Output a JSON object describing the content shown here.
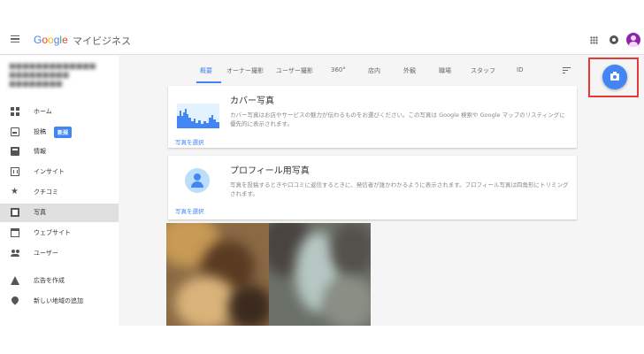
{
  "header": {
    "logo_parts": [
      "G",
      "o",
      "o",
      "g",
      "l",
      "e"
    ],
    "product": "マイビジネス"
  },
  "sidebar": {
    "business_name": "■■■■■■■■■■■■■ ■■■■■■■■■ ■■■■■■■■",
    "items": [
      {
        "label": "ホーム",
        "icon": "home-icon"
      },
      {
        "label": "投稿",
        "icon": "post-icon",
        "badge": "新規"
      },
      {
        "label": "情報",
        "icon": "info-icon"
      },
      {
        "label": "インサイト",
        "icon": "insight-icon"
      },
      {
        "label": "クチコミ",
        "icon": "star-icon",
        "glyph": "★"
      },
      {
        "label": "写真",
        "icon": "photo-icon",
        "active": true
      },
      {
        "label": "ウェブサイト",
        "icon": "website-icon"
      },
      {
        "label": "ユーザー",
        "icon": "users-icon"
      },
      {
        "label": "広告を作成",
        "icon": "ads-icon"
      },
      {
        "label": "新しい地域の追加",
        "icon": "location-pin-icon"
      }
    ]
  },
  "tabs": [
    "概要",
    "オーナー撮影",
    "ユーザー撮影",
    "360°",
    "店内",
    "外観",
    "職場",
    "スタッフ",
    "ID"
  ],
  "active_tab": "概要",
  "cover_card": {
    "title": "カバー写真",
    "description": "カバー写真はお店やサービスの魅力が伝わるものをお選びください。この写真は Google 検索や Google マップのリスティングに優先的に表示されます。",
    "link": "写真を選択"
  },
  "profile_card": {
    "title": "プロフィール用写真",
    "description": "写真を投稿するときや口コミに返信するときに、発信者が誰かわかるように表示されます。プロフィール写真は四角形にトリミングされます。",
    "link": "写真を選択"
  },
  "colors": {
    "accent": "#4285f4",
    "highlight": "#e53935",
    "active_nav_bg": "#e0e0e0"
  }
}
